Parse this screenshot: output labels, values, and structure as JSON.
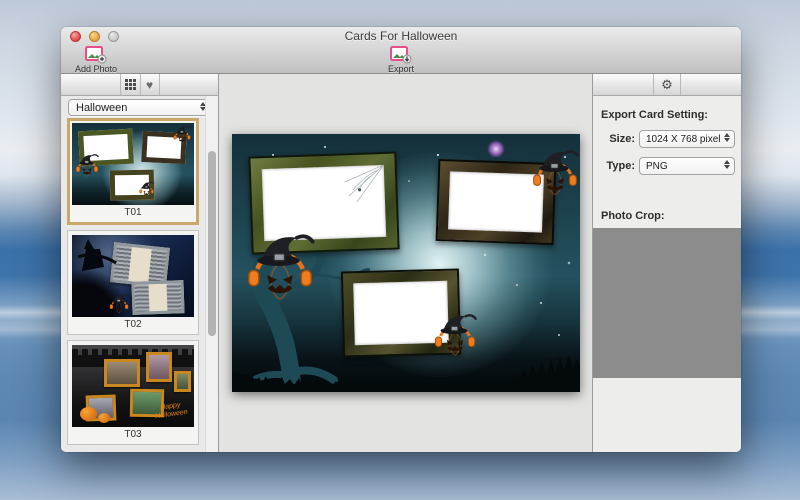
{
  "window": {
    "title": "Cards For Halloween"
  },
  "toolbar": {
    "add_photo_label": "Add Photo",
    "export_label": "Export"
  },
  "icons": {
    "heart_glyph": "♥",
    "gear_glyph": "⚙"
  },
  "sidebar": {
    "category_select": {
      "value": "Halloween"
    },
    "thumbnails": [
      {
        "label": "T01",
        "selected": true
      },
      {
        "label": "T02",
        "selected": false
      },
      {
        "label": "T03",
        "selected": false,
        "overlay_text": "Happy Halloween"
      }
    ]
  },
  "export_settings": {
    "title": "Export Card Setting:",
    "size_label": "Size:",
    "size_value": "1024 X 768 pixel",
    "type_label": "Type:",
    "type_value": "PNG",
    "photo_crop_label": "Photo Crop:"
  },
  "colors": {
    "selection_border": "#c9a96b",
    "pumpkin_orange": "#ef7c1e",
    "frame_green": "#55622e",
    "frame_brown": "#4c3f26",
    "canvas_teal": "#255160"
  }
}
